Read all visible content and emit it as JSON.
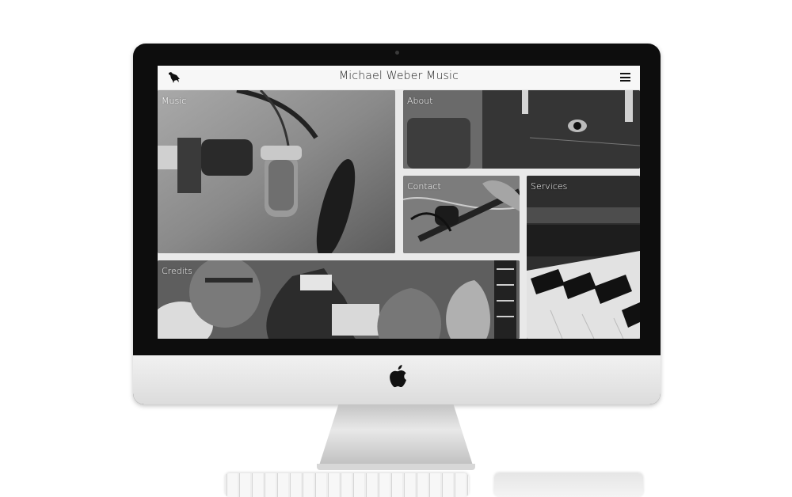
{
  "site": {
    "title": "Michael Weber Music",
    "logo_icon": "crow-icon",
    "menu_icon": "hamburger-menu-icon"
  },
  "tiles": {
    "music": "Music",
    "about": "About",
    "contact": "Contact",
    "services": "Services",
    "credits": "Credits"
  },
  "device": {
    "brand_icon": "apple-logo-icon"
  },
  "colors": {
    "screen_bg": "#e9e9e9",
    "header_bg": "#f7f7f7",
    "bezel": "#0d0d0d"
  }
}
